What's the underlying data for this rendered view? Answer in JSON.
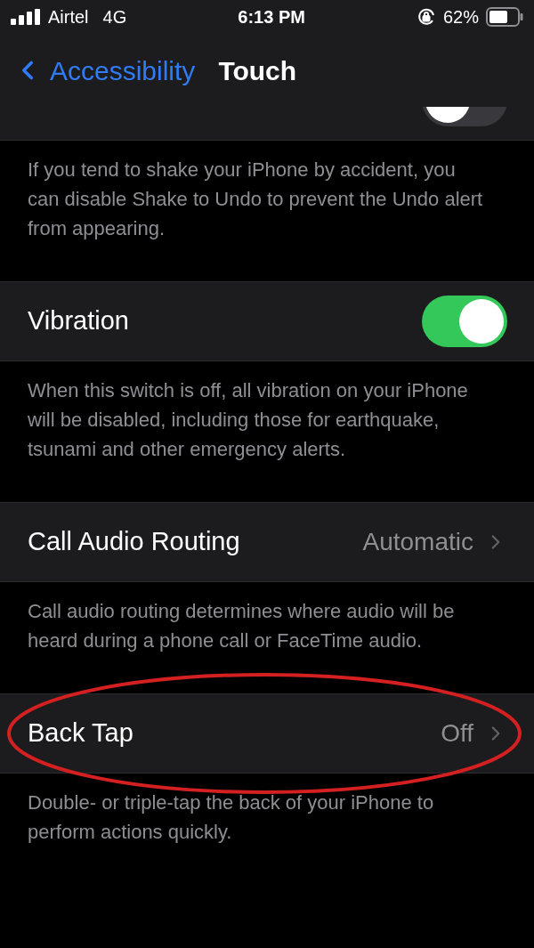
{
  "status_bar": {
    "carrier": "Airtel",
    "network": "4G",
    "time": "6:13 PM",
    "battery": "62%"
  },
  "nav": {
    "back": "Accessibility",
    "title": "Touch"
  },
  "sections": [
    {
      "kind": "toggle",
      "clipped": true,
      "on": false,
      "footer": "If you tend to shake your iPhone by accident, you can disable Shake to Undo to prevent the Undo alert from appearing."
    },
    {
      "kind": "toggle",
      "title": "Vibration",
      "on": true,
      "footer": "When this switch is off, all vibration on your iPhone will be disabled, including those for earthquake, tsunami and other emergency alerts."
    },
    {
      "kind": "link",
      "title": "Call Audio Routing",
      "value": "Automatic",
      "footer": "Call audio routing determines where audio will be heard during a phone call or FaceTime audio."
    },
    {
      "kind": "link",
      "title": "Back Tap",
      "value": "Off",
      "highlighted": true,
      "footer": "Double- or triple-tap the back of your iPhone to perform actions quickly."
    }
  ]
}
